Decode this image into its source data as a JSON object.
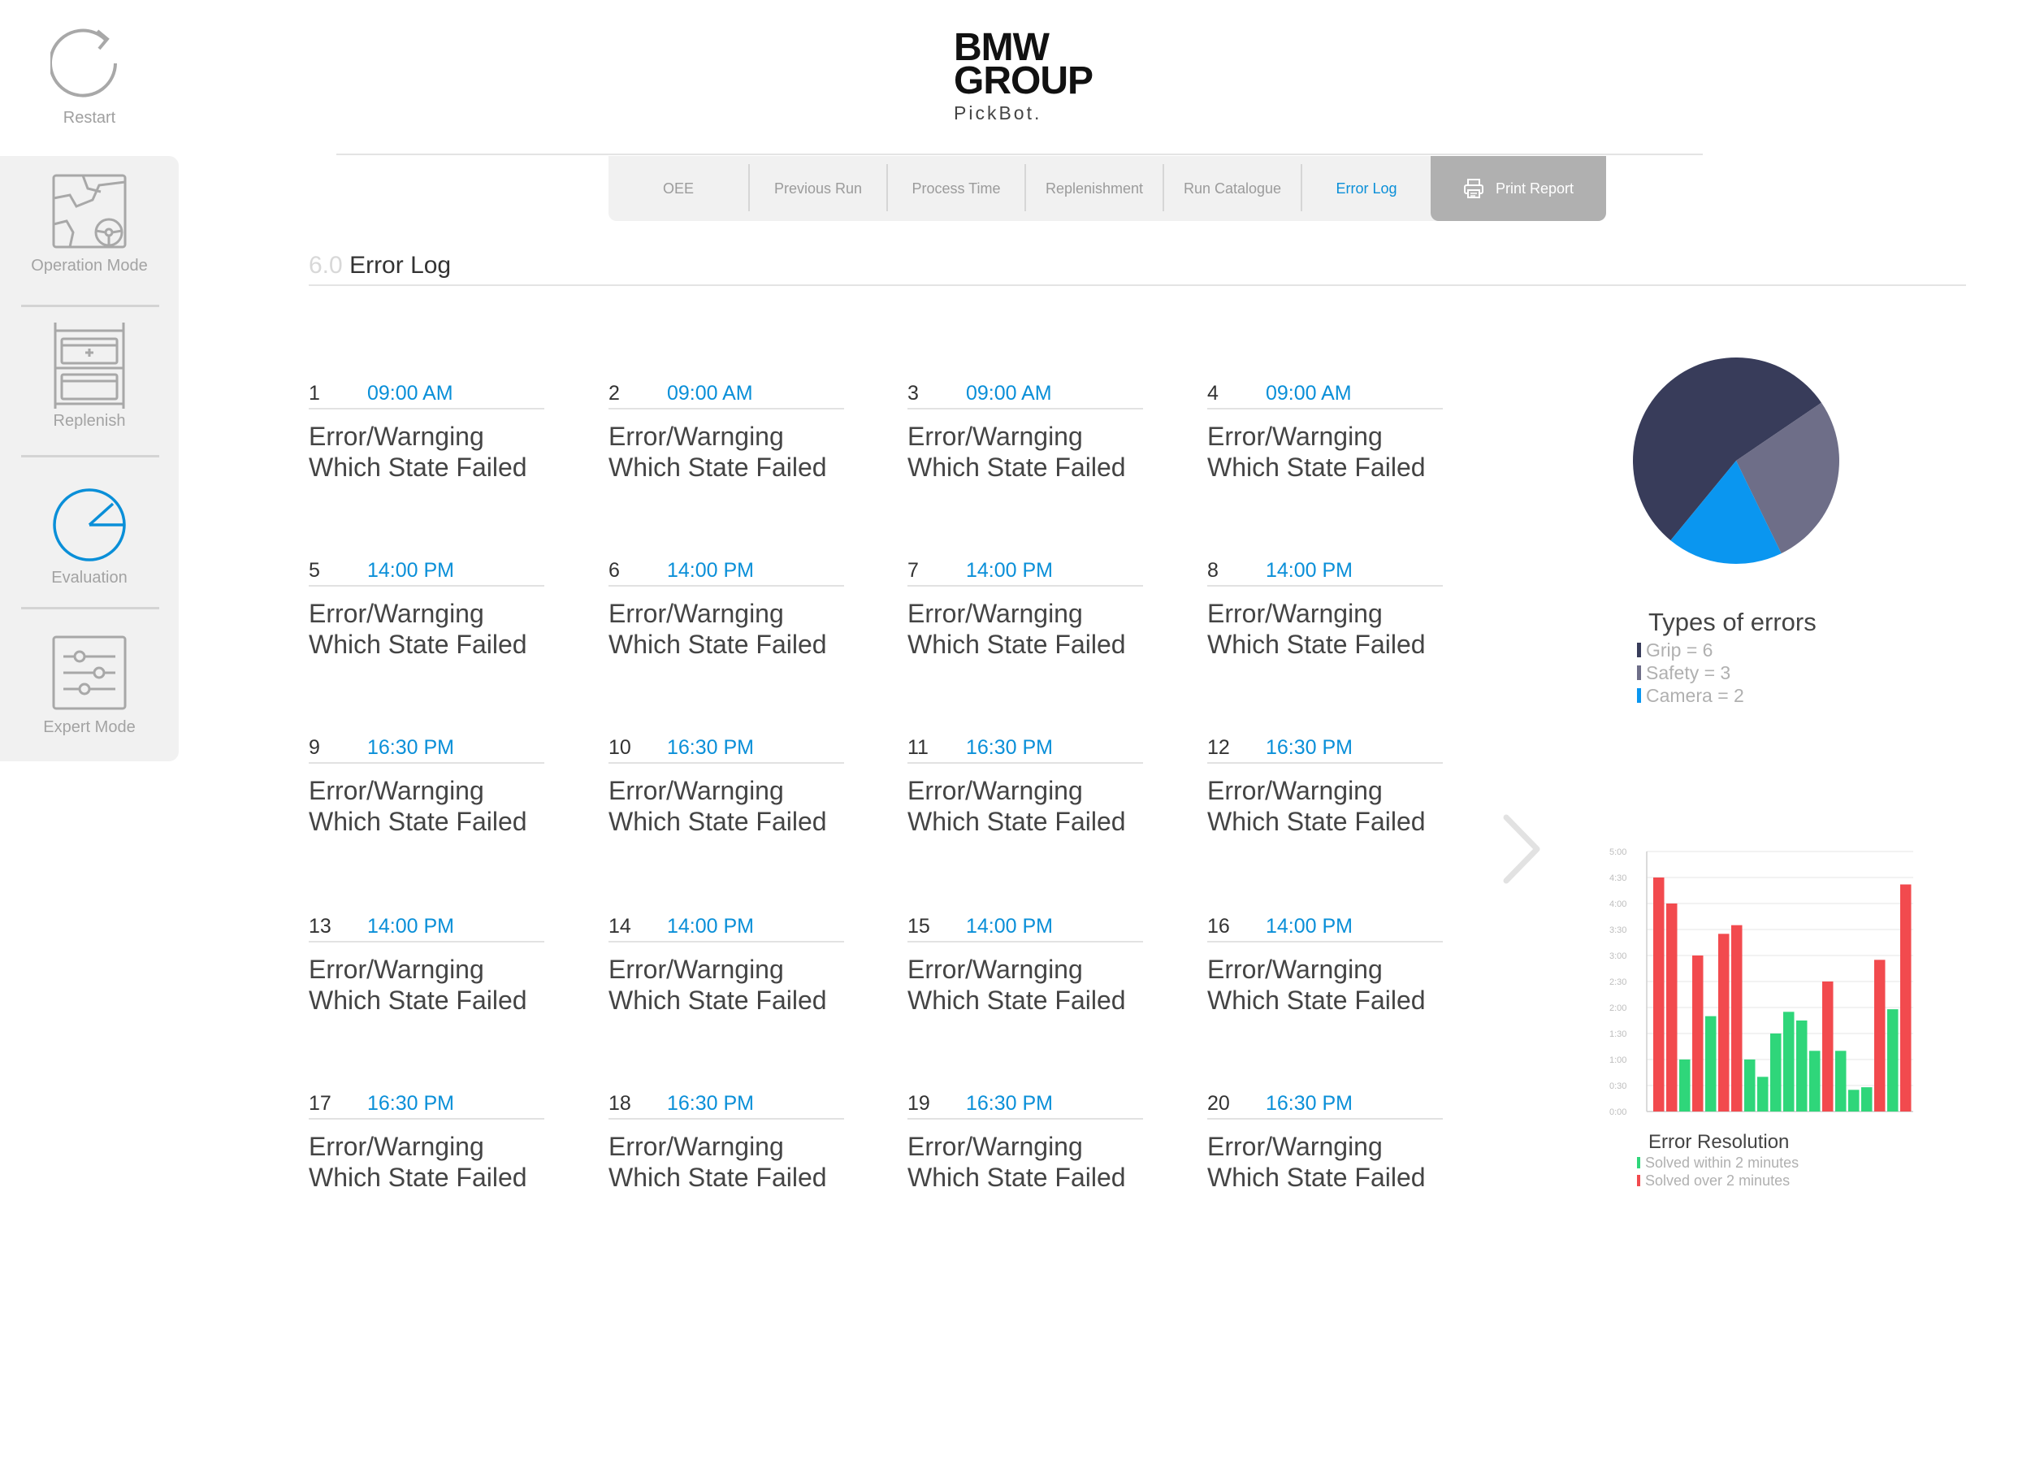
{
  "restart": {
    "label": "Restart"
  },
  "sidebar": {
    "items": [
      {
        "label": "Operation Mode",
        "icon": "map-steering-icon",
        "active": false
      },
      {
        "label": "Replenish",
        "icon": "rack-bins-icon",
        "active": false
      },
      {
        "label": "Evaluation",
        "icon": "pie-chart-icon",
        "active": true
      },
      {
        "label": "Expert Mode",
        "icon": "sliders-icon",
        "active": false
      }
    ]
  },
  "header": {
    "brand_line1": "BMW",
    "brand_line2": "GROUP",
    "product": "PickBot."
  },
  "tabs": [
    {
      "label": "OEE",
      "active": false
    },
    {
      "label": "Previous Run",
      "active": false
    },
    {
      "label": "Process Time",
      "active": false
    },
    {
      "label": "Replenishment",
      "active": false
    },
    {
      "label": "Run Catalogue",
      "active": false
    },
    {
      "label": "Error Log",
      "active": true
    }
  ],
  "print_button": {
    "label": "Print Report",
    "icon": "printer-icon"
  },
  "section": {
    "number": "6.0",
    "title": "Error Log"
  },
  "errors": [
    {
      "index": "1",
      "time": "09:00 AM",
      "line1": "Error/Warnging",
      "line2": "Which State Failed"
    },
    {
      "index": "2",
      "time": "09:00 AM",
      "line1": "Error/Warnging",
      "line2": "Which State Failed"
    },
    {
      "index": "3",
      "time": "09:00 AM",
      "line1": "Error/Warnging",
      "line2": "Which State Failed"
    },
    {
      "index": "4",
      "time": "09:00 AM",
      "line1": "Error/Warnging",
      "line2": "Which State Failed"
    },
    {
      "index": "5",
      "time": "14:00 PM",
      "line1": "Error/Warnging",
      "line2": "Which State Failed"
    },
    {
      "index": "6",
      "time": "14:00 PM",
      "line1": "Error/Warnging",
      "line2": "Which State Failed"
    },
    {
      "index": "7",
      "time": "14:00 PM",
      "line1": "Error/Warnging",
      "line2": "Which State Failed"
    },
    {
      "index": "8",
      "time": "14:00 PM",
      "line1": "Error/Warnging",
      "line2": "Which State Failed"
    },
    {
      "index": "9",
      "time": "16:30 PM",
      "line1": "Error/Warnging",
      "line2": "Which State Failed"
    },
    {
      "index": "10",
      "time": "16:30 PM",
      "line1": "Error/Warnging",
      "line2": "Which State Failed"
    },
    {
      "index": "11",
      "time": "16:30 PM",
      "line1": "Error/Warnging",
      "line2": "Which State Failed"
    },
    {
      "index": "12",
      "time": "16:30 PM",
      "line1": "Error/Warnging",
      "line2": "Which State Failed"
    },
    {
      "index": "13",
      "time": "14:00 PM",
      "line1": "Error/Warnging",
      "line2": "Which State Failed"
    },
    {
      "index": "14",
      "time": "14:00 PM",
      "line1": "Error/Warnging",
      "line2": "Which State Failed"
    },
    {
      "index": "15",
      "time": "14:00 PM",
      "line1": "Error/Warnging",
      "line2": "Which State Failed"
    },
    {
      "index": "16",
      "time": "14:00 PM",
      "line1": "Error/Warnging",
      "line2": "Which State Failed"
    },
    {
      "index": "17",
      "time": "16:30 PM",
      "line1": "Error/Warnging",
      "line2": "Which State Failed"
    },
    {
      "index": "18",
      "time": "16:30 PM",
      "line1": "Error/Warnging",
      "line2": "Which State Failed"
    },
    {
      "index": "19",
      "time": "16:30 PM",
      "line1": "Error/Warnging",
      "line2": "Which State Failed"
    },
    {
      "index": "20",
      "time": "16:30 PM",
      "line1": "Error/Warnging",
      "line2": "Which State Failed"
    }
  ],
  "next_icon": "chevron-right-icon",
  "colors": {
    "accent": "#0a8fd8",
    "grip": "#383c5a",
    "safety": "#6e6e88",
    "camera": "#0a96f0",
    "within": "#2fd67a",
    "over": "#f24a4e"
  },
  "chart_data": [
    {
      "type": "pie",
      "title": "Types of errors",
      "series": [
        {
          "name": "Grip",
          "label": "Grip = 6",
          "value": 6,
          "color": "#383c5a"
        },
        {
          "name": "Safety",
          "label": "Safety = 3",
          "value": 3,
          "color": "#6e6e88"
        },
        {
          "name": "Camera",
          "label": "Camera = 2",
          "value": 2,
          "color": "#0a96f0"
        }
      ]
    },
    {
      "type": "bar",
      "title": "Error Resolution",
      "y_ticks": [
        "0:00",
        "0:30",
        "1:00",
        "1:30",
        "2:00",
        "2:30",
        "3:00",
        "3:30",
        "4:00",
        "4:30",
        "5:00"
      ],
      "ylim": [
        0,
        300
      ],
      "grid": true,
      "series": [
        {
          "name": "Solved within 2 minutes",
          "color": "#2fd67a"
        },
        {
          "name": "Solved over 2 minutes",
          "color": "#f24a4e"
        }
      ],
      "bars": [
        {
          "value": 270,
          "series": 1
        },
        {
          "value": 240,
          "series": 1
        },
        {
          "value": 60,
          "series": 0
        },
        {
          "value": 180,
          "series": 1
        },
        {
          "value": 110,
          "series": 0
        },
        {
          "value": 205,
          "series": 1
        },
        {
          "value": 215,
          "series": 1
        },
        {
          "value": 60,
          "series": 0
        },
        {
          "value": 40,
          "series": 0
        },
        {
          "value": 90,
          "series": 0
        },
        {
          "value": 115,
          "series": 0
        },
        {
          "value": 105,
          "series": 0
        },
        {
          "value": 70,
          "series": 0
        },
        {
          "value": 150,
          "series": 1
        },
        {
          "value": 70,
          "series": 0
        },
        {
          "value": 25,
          "series": 0
        },
        {
          "value": 28,
          "series": 0
        },
        {
          "value": 175,
          "series": 1
        },
        {
          "value": 118,
          "series": 0
        },
        {
          "value": 262,
          "series": 1
        }
      ]
    }
  ]
}
